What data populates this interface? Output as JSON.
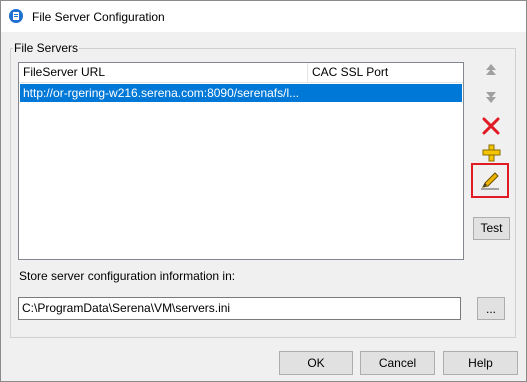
{
  "window": {
    "title": "File Server Configuration",
    "app_icon": "serena-app-icon"
  },
  "file_servers": {
    "group_label": "File Servers",
    "columns": [
      "FileServer URL",
      "CAC SSL Port"
    ],
    "rows": [
      {
        "url": "http://or-rgering-w216.serena.com:8090/serenafs/l...",
        "port": "",
        "selected": true
      }
    ]
  },
  "side_toolbar": {
    "move_up_icon": "move-up-arrow-icon",
    "move_down_icon": "move-down-arrow-icon",
    "delete_icon": "red-x-delete-icon",
    "add_icon": "yellow-plus-add-icon",
    "edit_icon": "pencil-edit-icon",
    "test_label": "Test"
  },
  "storage": {
    "label": "Store server configuration information in:",
    "path_value": "C:\\ProgramData\\Serena\\VM\\servers.ini",
    "browse_label": "..."
  },
  "footer": {
    "ok_label": "OK",
    "cancel_label": "Cancel",
    "help_label": "Help"
  },
  "colors": {
    "selection": "#0078d7",
    "highlight_box": "#e01b24",
    "delete_red": "#e01b24",
    "add_yellow": "#f5c400",
    "disabled_gray": "#a0a0a0"
  }
}
